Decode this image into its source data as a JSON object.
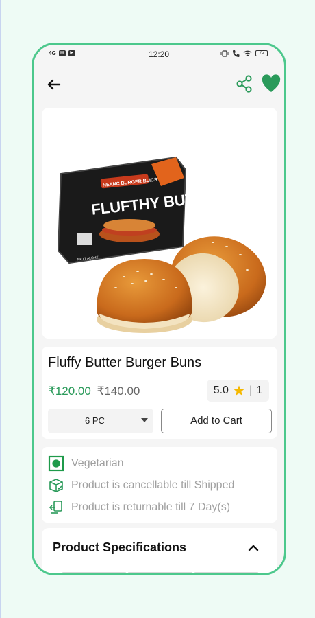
{
  "status_bar": {
    "time": "12:20",
    "signal_text": "4G",
    "battery": "75"
  },
  "header": {
    "back_icon": "arrow-left-icon",
    "share_icon": "share-icon",
    "favorite_icon": "heart-icon"
  },
  "product_image": {
    "brand_banner": "NEANC BURGER BLICS",
    "package_text": "FLUFTHY BUTGER",
    "package_small_text": "NETT ALOHT"
  },
  "product": {
    "title": "Fluffy Butter Burger Buns",
    "price": "₹120.00",
    "original_price": "₹140.00",
    "rating": "5.0",
    "review_count": "1",
    "variant": "6 PC",
    "add_to_cart": "Add to Cart"
  },
  "attributes": [
    {
      "icon": "veg-icon",
      "label": "Vegetarian"
    },
    {
      "icon": "cancel-box-icon",
      "label": "Product is cancellable till Shipped"
    },
    {
      "icon": "return-icon",
      "label": "Product is returnable till 7 Day(s)"
    }
  ],
  "specifications": {
    "title": "Product Specifications",
    "toggle_icon": "chevron-up-icon"
  },
  "colors": {
    "accent": "#2a9a5a",
    "frame": "#4cc88c",
    "star": "#f5b800"
  }
}
